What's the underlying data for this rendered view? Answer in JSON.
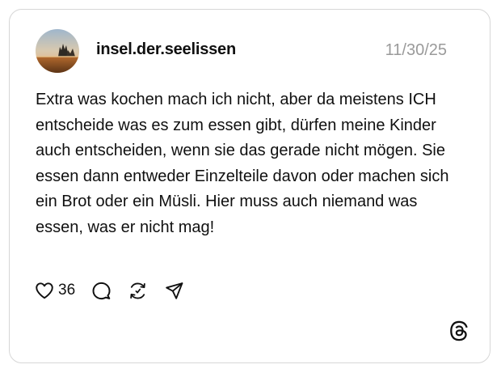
{
  "post": {
    "username": "insel.der.seelissen",
    "timestamp": "11/30/25",
    "text": "Extra was kochen mach ich nicht, aber da meistens ICH entscheide was es zum essen gibt, dürfen meine Kinder auch entscheiden, wenn sie das gerade nicht mögen. Sie essen dann entweder Einzelteile davon oder machen sich ein Brot oder ein Müsli. Hier muss auch niemand was essen, was er nicht mag!",
    "like_count": "36"
  },
  "icons": {
    "like": "heart-icon",
    "comment": "comment-bubble-icon",
    "repost": "repost-icon",
    "share": "send-icon",
    "brand": "threads-logo-icon"
  },
  "colors": {
    "text": "#101010",
    "muted": "#9a9a9a",
    "border": "#d6d6d6"
  }
}
